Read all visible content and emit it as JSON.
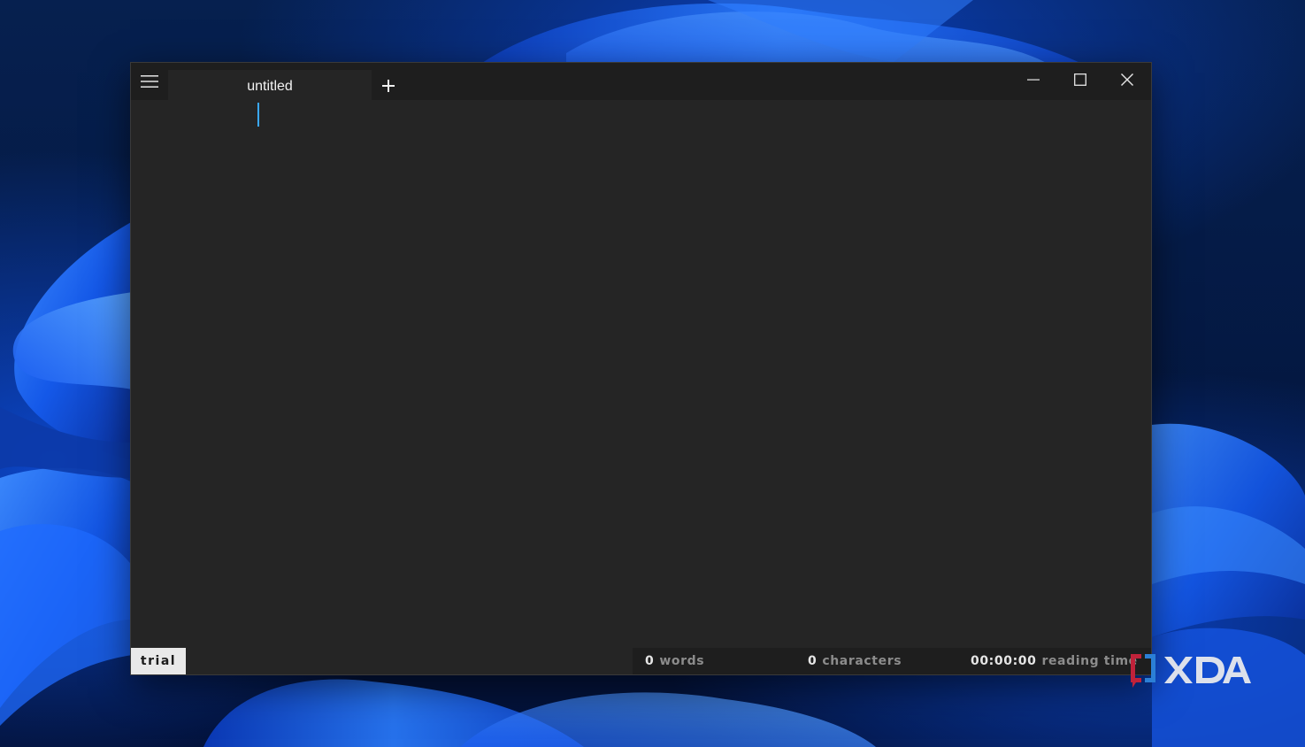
{
  "window": {
    "tab_title": "untitled",
    "add_tab_symbol": "+"
  },
  "editor": {
    "content": ""
  },
  "status": {
    "trial_label": "trial",
    "words_count": "0",
    "words_label": "words",
    "chars_count": "0",
    "chars_label": "characters",
    "reading_time": "00:00:00",
    "reading_time_label": "reading time"
  },
  "watermark": {
    "text": "XDA"
  },
  "icons": {
    "menu": "hamburger-menu-icon",
    "add": "plus-icon",
    "minimize": "minimize-icon",
    "maximize": "maximize-icon",
    "close": "close-icon",
    "watermark_logo": "xda-logo-icon"
  },
  "colors": {
    "window_bg": "#252525",
    "titlebar_bg": "#1e1e1e",
    "caret": "#3aa8ff",
    "trial_badge_bg": "#e9e9e9",
    "desktop_accent": "#1a6bff"
  }
}
